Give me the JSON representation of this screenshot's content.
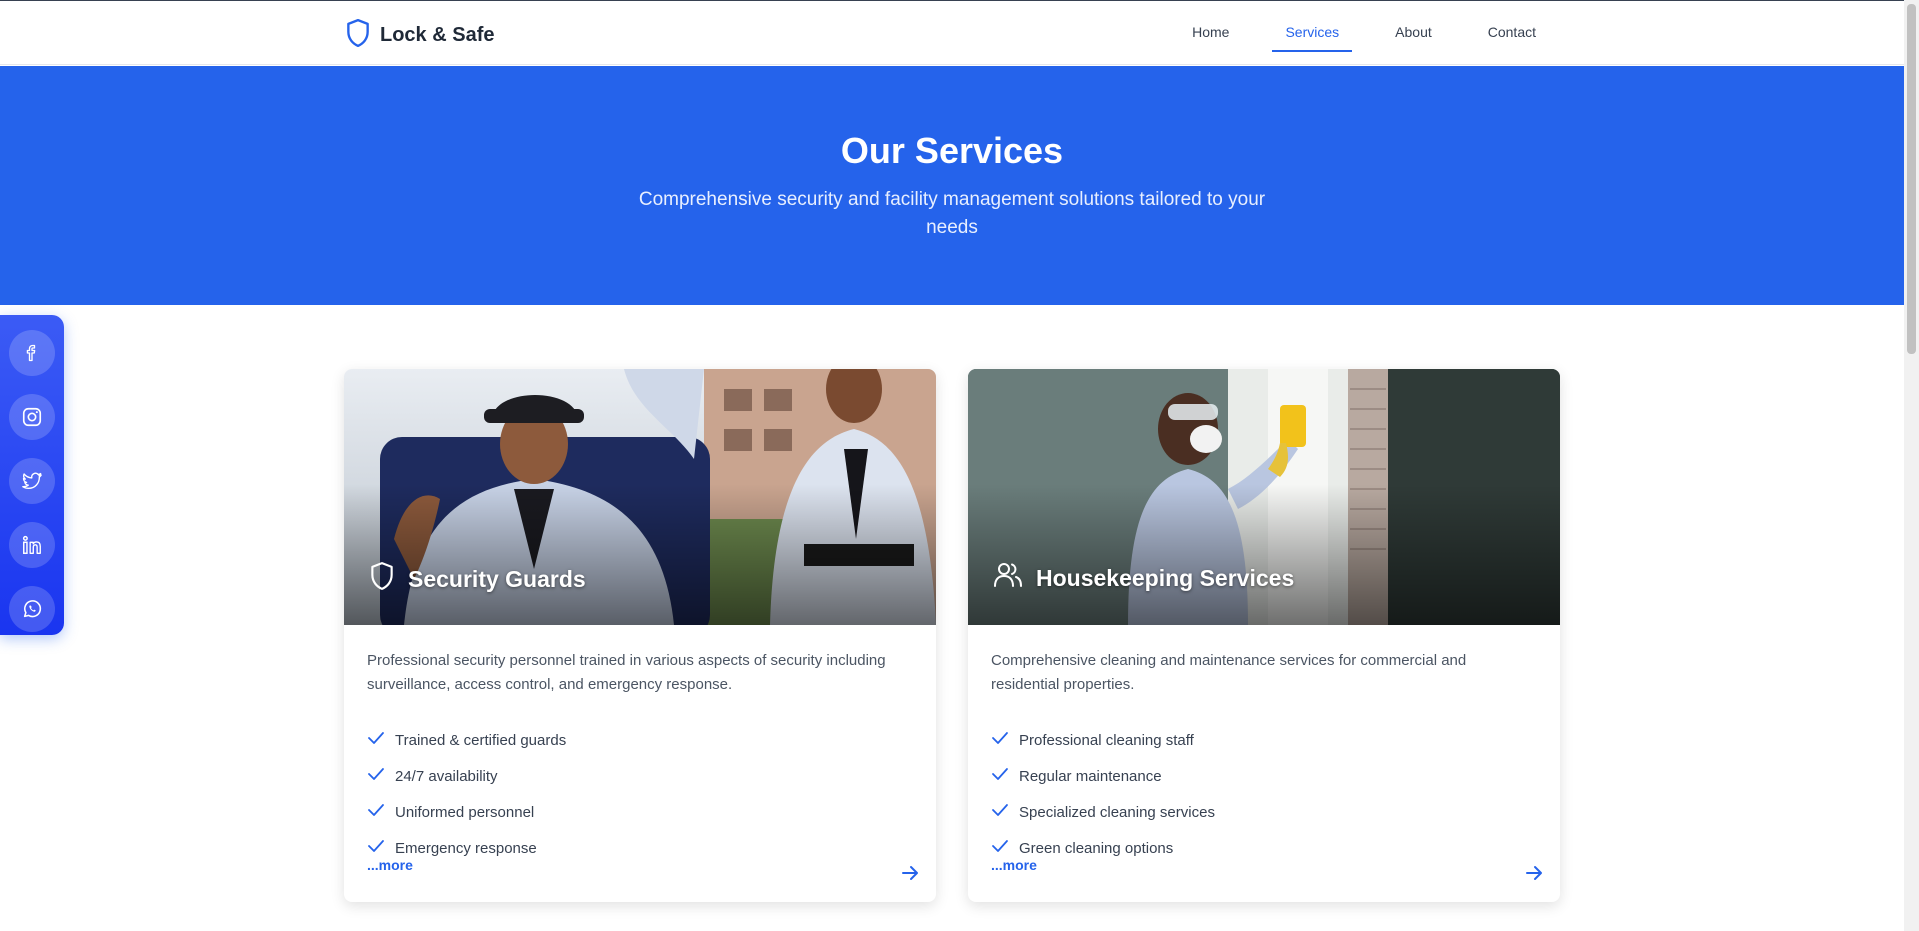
{
  "header": {
    "logo_icon": "shield-icon",
    "brand": "Lock & Safe",
    "nav": [
      {
        "label": "Home",
        "active": false
      },
      {
        "label": "Services",
        "active": true
      },
      {
        "label": "About",
        "active": false
      },
      {
        "label": "Contact",
        "active": false
      }
    ]
  },
  "hero": {
    "title": "Our Services",
    "subtitle": "Comprehensive security and facility management solutions tailored to your needs"
  },
  "social": {
    "icons": [
      "facebook-icon",
      "instagram-icon",
      "twitter-icon",
      "linkedin-icon",
      "whatsapp-icon"
    ]
  },
  "services": [
    {
      "title": "Security Guards",
      "icon": "shield-icon",
      "description": "Professional security personnel trained in various aspects of security including surveillance, access control, and emergency response.",
      "features": [
        "Trained & certified guards",
        "24/7 availability",
        "Uniformed personnel",
        "Emergency response"
      ],
      "more_label": "...more"
    },
    {
      "title": "Housekeeping Services",
      "icon": "users-icon",
      "description": "Comprehensive cleaning and maintenance services for commercial and residential properties.",
      "features": [
        "Professional cleaning staff",
        "Regular maintenance",
        "Specialized cleaning services",
        "Green cleaning options"
      ],
      "more_label": "...more"
    }
  ],
  "colors": {
    "primary": "#2563eb",
    "social_bar": "#1a35f0",
    "text_dark": "#1f2937",
    "text_muted": "#4b5563"
  }
}
